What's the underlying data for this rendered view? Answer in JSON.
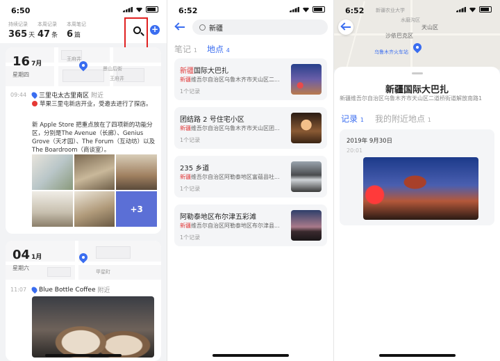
{
  "panel1": {
    "time": "6:50",
    "stats": [
      {
        "label": "持续记录",
        "value": "365",
        "unit": "天"
      },
      {
        "label": "本周记录",
        "value": "47",
        "unit": "条"
      },
      {
        "label": "本周笔记",
        "value": "6",
        "unit": "篇"
      }
    ],
    "add_label": "+",
    "day1": {
      "day": "16",
      "month": "7月",
      "weekday": "星期四",
      "map_labels": [
        "王府井",
        "景山后街",
        "王府井"
      ],
      "entry_time": "09:44",
      "location": "三里屯太古里南区",
      "nearby": "附近",
      "text1": "苹果三里屯新店开业，受邀去进行了探店。",
      "text2": "新 Apple Store 把重点放在了四项新的功能分区，分别是The Avenue（长廊）、Genius Grove（天才园）、The Forum（互动坊）以及 The Boardroom（商谈室）。",
      "more_photos": "+3"
    },
    "day2": {
      "day": "04",
      "month": "1月",
      "weekday": "星期六",
      "map_label": "甲星町",
      "entry_time": "11:07",
      "location": "Blue Bottle Coffee",
      "nearby": "附近"
    }
  },
  "panel2": {
    "time": "6:52",
    "search_value": "新疆",
    "tabs": [
      {
        "label": "笔记",
        "count": "1"
      },
      {
        "label": "地点",
        "count": "4"
      }
    ],
    "results": [
      {
        "hl": "新疆",
        "rest": "国际大巴扎",
        "addr_hl": "新疆",
        "addr": "维吾尔自治区乌鲁木齐市天山区二...",
        "count": "1个记录"
      },
      {
        "hl": "",
        "rest": "团结路 2 号住宅小区",
        "addr_hl": "新疆",
        "addr": "维吾尔自治区乌鲁木齐市天山区团...",
        "count": "1个记录"
      },
      {
        "hl": "",
        "rest": "235 乡道",
        "addr_hl": "新疆",
        "addr": "维吾尔自治区阿勒泰地区富蕴县吐...",
        "count": "1个记录"
      },
      {
        "hl": "",
        "rest": "阿勒泰地区布尔津五彩滩",
        "addr_hl": "新疆",
        "addr": "维吾尔自治区阿勒泰地区布尔津县...",
        "count": "1个记录"
      }
    ]
  },
  "panel3": {
    "time": "6:52",
    "map_labels": [
      "新疆农业大学",
      "水磨沟区",
      "天山区",
      "沙依巴克区",
      "乌鲁木齐火车站"
    ],
    "title": "新疆国际大巴扎",
    "address": "新疆维吾尔自治区乌鲁木齐市天山区二道桥街道解放南路1",
    "tabs": [
      {
        "label": "记录",
        "count": "1"
      },
      {
        "label": "我的附近地点",
        "count": "1"
      }
    ],
    "record_date": "2019年 9月30日",
    "record_time": "20:01"
  },
  "colors": {
    "accent": "#3a6df0",
    "highlight": "#e03c3c",
    "annotation": "#e02020"
  }
}
